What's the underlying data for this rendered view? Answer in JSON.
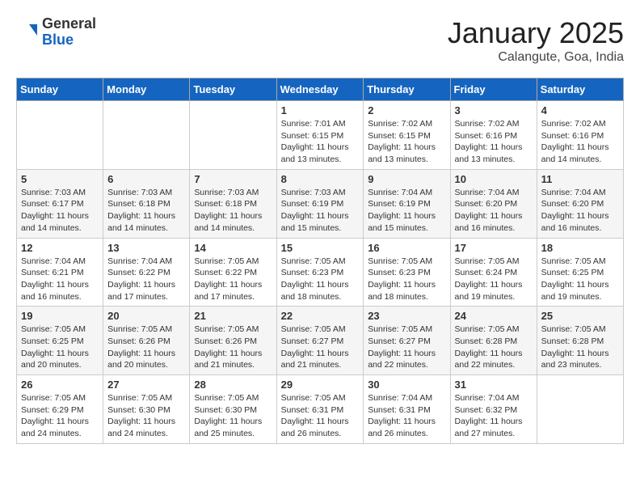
{
  "header": {
    "logo_general": "General",
    "logo_blue": "Blue",
    "month_title": "January 2025",
    "location": "Calangute, Goa, India"
  },
  "days_of_week": [
    "Sunday",
    "Monday",
    "Tuesday",
    "Wednesday",
    "Thursday",
    "Friday",
    "Saturday"
  ],
  "weeks": [
    [
      {
        "day": "",
        "info": ""
      },
      {
        "day": "",
        "info": ""
      },
      {
        "day": "",
        "info": ""
      },
      {
        "day": "1",
        "info": "Sunrise: 7:01 AM\nSunset: 6:15 PM\nDaylight: 11 hours\nand 13 minutes."
      },
      {
        "day": "2",
        "info": "Sunrise: 7:02 AM\nSunset: 6:15 PM\nDaylight: 11 hours\nand 13 minutes."
      },
      {
        "day": "3",
        "info": "Sunrise: 7:02 AM\nSunset: 6:16 PM\nDaylight: 11 hours\nand 13 minutes."
      },
      {
        "day": "4",
        "info": "Sunrise: 7:02 AM\nSunset: 6:16 PM\nDaylight: 11 hours\nand 14 minutes."
      }
    ],
    [
      {
        "day": "5",
        "info": "Sunrise: 7:03 AM\nSunset: 6:17 PM\nDaylight: 11 hours\nand 14 minutes."
      },
      {
        "day": "6",
        "info": "Sunrise: 7:03 AM\nSunset: 6:18 PM\nDaylight: 11 hours\nand 14 minutes."
      },
      {
        "day": "7",
        "info": "Sunrise: 7:03 AM\nSunset: 6:18 PM\nDaylight: 11 hours\nand 14 minutes."
      },
      {
        "day": "8",
        "info": "Sunrise: 7:03 AM\nSunset: 6:19 PM\nDaylight: 11 hours\nand 15 minutes."
      },
      {
        "day": "9",
        "info": "Sunrise: 7:04 AM\nSunset: 6:19 PM\nDaylight: 11 hours\nand 15 minutes."
      },
      {
        "day": "10",
        "info": "Sunrise: 7:04 AM\nSunset: 6:20 PM\nDaylight: 11 hours\nand 16 minutes."
      },
      {
        "day": "11",
        "info": "Sunrise: 7:04 AM\nSunset: 6:20 PM\nDaylight: 11 hours\nand 16 minutes."
      }
    ],
    [
      {
        "day": "12",
        "info": "Sunrise: 7:04 AM\nSunset: 6:21 PM\nDaylight: 11 hours\nand 16 minutes."
      },
      {
        "day": "13",
        "info": "Sunrise: 7:04 AM\nSunset: 6:22 PM\nDaylight: 11 hours\nand 17 minutes."
      },
      {
        "day": "14",
        "info": "Sunrise: 7:05 AM\nSunset: 6:22 PM\nDaylight: 11 hours\nand 17 minutes."
      },
      {
        "day": "15",
        "info": "Sunrise: 7:05 AM\nSunset: 6:23 PM\nDaylight: 11 hours\nand 18 minutes."
      },
      {
        "day": "16",
        "info": "Sunrise: 7:05 AM\nSunset: 6:23 PM\nDaylight: 11 hours\nand 18 minutes."
      },
      {
        "day": "17",
        "info": "Sunrise: 7:05 AM\nSunset: 6:24 PM\nDaylight: 11 hours\nand 19 minutes."
      },
      {
        "day": "18",
        "info": "Sunrise: 7:05 AM\nSunset: 6:25 PM\nDaylight: 11 hours\nand 19 minutes."
      }
    ],
    [
      {
        "day": "19",
        "info": "Sunrise: 7:05 AM\nSunset: 6:25 PM\nDaylight: 11 hours\nand 20 minutes."
      },
      {
        "day": "20",
        "info": "Sunrise: 7:05 AM\nSunset: 6:26 PM\nDaylight: 11 hours\nand 20 minutes."
      },
      {
        "day": "21",
        "info": "Sunrise: 7:05 AM\nSunset: 6:26 PM\nDaylight: 11 hours\nand 21 minutes."
      },
      {
        "day": "22",
        "info": "Sunrise: 7:05 AM\nSunset: 6:27 PM\nDaylight: 11 hours\nand 21 minutes."
      },
      {
        "day": "23",
        "info": "Sunrise: 7:05 AM\nSunset: 6:27 PM\nDaylight: 11 hours\nand 22 minutes."
      },
      {
        "day": "24",
        "info": "Sunrise: 7:05 AM\nSunset: 6:28 PM\nDaylight: 11 hours\nand 22 minutes."
      },
      {
        "day": "25",
        "info": "Sunrise: 7:05 AM\nSunset: 6:28 PM\nDaylight: 11 hours\nand 23 minutes."
      }
    ],
    [
      {
        "day": "26",
        "info": "Sunrise: 7:05 AM\nSunset: 6:29 PM\nDaylight: 11 hours\nand 24 minutes."
      },
      {
        "day": "27",
        "info": "Sunrise: 7:05 AM\nSunset: 6:30 PM\nDaylight: 11 hours\nand 24 minutes."
      },
      {
        "day": "28",
        "info": "Sunrise: 7:05 AM\nSunset: 6:30 PM\nDaylight: 11 hours\nand 25 minutes."
      },
      {
        "day": "29",
        "info": "Sunrise: 7:05 AM\nSunset: 6:31 PM\nDaylight: 11 hours\nand 26 minutes."
      },
      {
        "day": "30",
        "info": "Sunrise: 7:04 AM\nSunset: 6:31 PM\nDaylight: 11 hours\nand 26 minutes."
      },
      {
        "day": "31",
        "info": "Sunrise: 7:04 AM\nSunset: 6:32 PM\nDaylight: 11 hours\nand 27 minutes."
      },
      {
        "day": "",
        "info": ""
      }
    ]
  ]
}
